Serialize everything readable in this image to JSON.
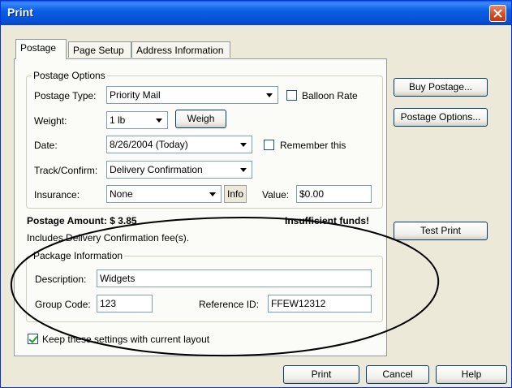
{
  "window": {
    "title": "Print"
  },
  "tabs": [
    {
      "label": "Postage",
      "active": true
    },
    {
      "label": "Page Setup",
      "active": false
    },
    {
      "label": "Address Information",
      "active": false
    }
  ],
  "postage_options": {
    "group_label": "Postage Options",
    "postage_type_label": "Postage Type:",
    "postage_type_value": "Priority Mail",
    "balloon_rate_label": "Balloon Rate",
    "balloon_rate_checked": false,
    "weight_label": "Weight:",
    "weight_value": "1 lb",
    "weigh_button": "Weigh",
    "date_label": "Date:",
    "date_value": "8/26/2004 (Today)",
    "remember_label": "Remember this",
    "remember_checked": false,
    "track_label": "Track/Confirm:",
    "track_value": "Delivery Confirmation",
    "insurance_label": "Insurance:",
    "insurance_value": "None",
    "info_button": "Info",
    "value_label": "Value:",
    "value_value": "$0.00"
  },
  "postage_amount": {
    "label": "Postage Amount: $ 3.85",
    "warning": "Insufficient funds!",
    "note": "Includes Delivery Confirmation fee(s)."
  },
  "package_info": {
    "group_label": "Package Information",
    "description_label": "Description:",
    "description_value": "Widgets",
    "group_code_label": "Group Code:",
    "group_code_value": "123",
    "reference_label": "Reference ID:",
    "reference_value": "FFEW12312"
  },
  "keep_settings": {
    "label": "Keep these settings with current layout",
    "checked": true
  },
  "side_buttons": {
    "buy_postage": "Buy Postage...",
    "postage_options": "Postage Options...",
    "test_print": "Test Print"
  },
  "bottom_buttons": {
    "print": "Print",
    "cancel": "Cancel",
    "help": "Help"
  },
  "colors": {
    "title_bar": "#0a5fe5",
    "dialog_bg": "#ece9d8",
    "annotation": "#000000"
  }
}
